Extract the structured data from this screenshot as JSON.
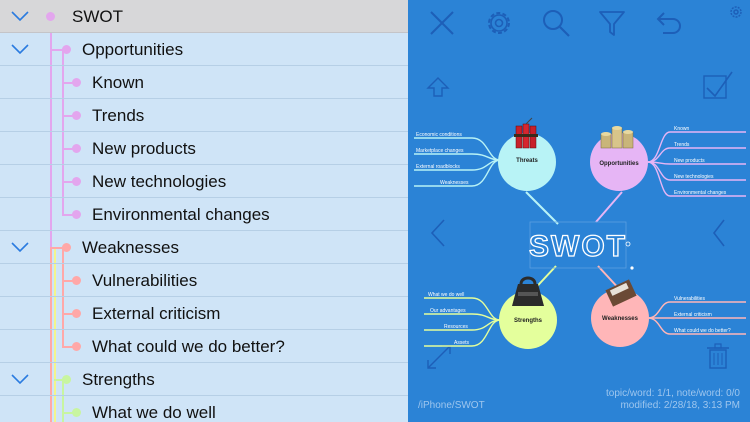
{
  "outline": {
    "rows": [
      {
        "label": "SWOT",
        "level": 0,
        "expandable": true,
        "selected": true
      },
      {
        "label": "Opportunities",
        "level": 1,
        "expandable": true
      },
      {
        "label": "Known",
        "level": 2
      },
      {
        "label": "Trends",
        "level": 2
      },
      {
        "label": "New products",
        "level": 2
      },
      {
        "label": "New technologies",
        "level": 2
      },
      {
        "label": "Environmental changes",
        "level": 2
      },
      {
        "label": "Weaknesses",
        "level": 1,
        "expandable": true
      },
      {
        "label": "Vulnerabilities",
        "level": 2
      },
      {
        "label": "External criticism",
        "level": 2
      },
      {
        "label": "What could we do better?",
        "level": 2
      },
      {
        "label": "Strengths",
        "level": 1,
        "expandable": true
      },
      {
        "label": "What we do well",
        "level": 2
      }
    ]
  },
  "toolbar": {
    "icons": [
      "close-icon",
      "gear-icon",
      "search-icon",
      "filter-icon",
      "undo-icon",
      "settings-small-icon"
    ]
  },
  "map": {
    "center": "SWOT",
    "topics": {
      "threats": {
        "label": "Threats",
        "children": [
          "Economic conditions",
          "Marketplace changes",
          "External roadblocks",
          "Weaknesses"
        ]
      },
      "opportunities": {
        "label": "Opportunities",
        "children": [
          "Known",
          "Trends",
          "New products",
          "New technologies",
          "Environmental changes"
        ]
      },
      "strengths": {
        "label": "Strengths",
        "children": [
          "What we do well",
          "Our advantages",
          "Resources",
          "Assets"
        ]
      },
      "weaknesses": {
        "label": "Weaknesses",
        "children": [
          "Vulnerabilities",
          "External criticism",
          "What could we do better?"
        ]
      }
    },
    "path": "/iPhone/SWOT",
    "status_line1": "topic/word: 1/1, note/word: 0/0",
    "status_line2": "modified: 2/28/18, 3:13 PM"
  },
  "colors": {
    "outline_bg": "#cfe4f7",
    "selected_row": "#d7d7d9",
    "map_bg": "#2b83d6",
    "swot_line": "#e3a6ee",
    "opportunities_line": "#e3a6ee",
    "weaknesses_line": "#ffa8a8",
    "strengths_line": "#c8f5a0",
    "threats_circle": "#b8f3f6",
    "opportunities_circle": "#e6b5f5",
    "strengths_circle": "#e4ff9c",
    "weaknesses_circle": "#ffb6b8"
  }
}
